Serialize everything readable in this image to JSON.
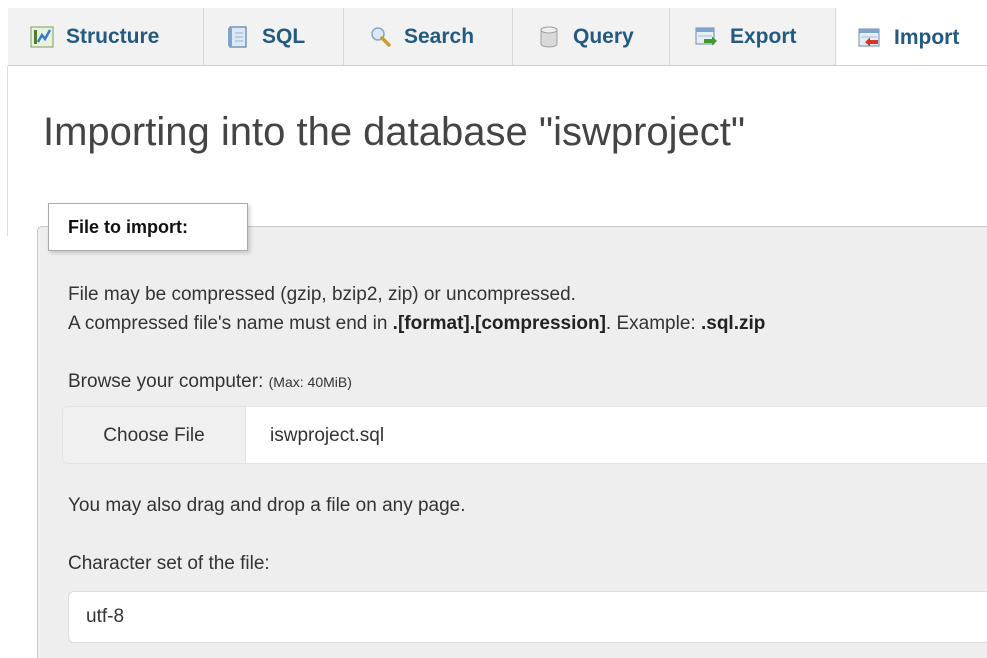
{
  "tabs": [
    {
      "label": "Structure",
      "icon": "structure-icon"
    },
    {
      "label": "SQL",
      "icon": "sql-icon"
    },
    {
      "label": "Search",
      "icon": "search-icon"
    },
    {
      "label": "Query",
      "icon": "query-icon"
    },
    {
      "label": "Export",
      "icon": "export-icon"
    },
    {
      "label": "Import",
      "icon": "import-icon",
      "active": true
    }
  ],
  "page": {
    "title": "Importing into the database \"iswproject\""
  },
  "import_form": {
    "legend": "File to import:",
    "compression_note": "File may be compressed (gzip, bzip2, zip) or uncompressed.",
    "name_note_prefix": "A compressed file's name must end in ",
    "name_note_format": ".[format].[compression]",
    "name_note_middle": ". Example: ",
    "name_note_example": ".sql.zip",
    "browse_label": "Browse your computer: ",
    "browse_max": "(Max: 40MiB)",
    "choose_file_label": "Choose File",
    "selected_file": "iswproject.sql",
    "drag_drop_note": "You may also drag and drop a file on any page.",
    "charset_label": "Character set of the file:",
    "charset_value": "utf-8"
  },
  "colors": {
    "tab_text": "#235a81",
    "tab_bar_bg": "#f2f2f2",
    "fieldset_bg": "#eeeeee",
    "title_text": "#444444"
  }
}
